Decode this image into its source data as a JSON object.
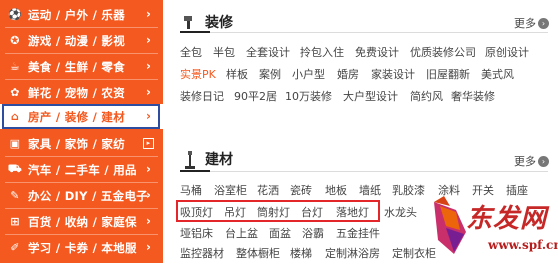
{
  "sidebar": {
    "items": [
      {
        "label": "运动 / 户外 / 乐器",
        "icon": "sports-icon"
      },
      {
        "label": "游戏 / 动漫 / 影视",
        "icon": "game-icon"
      },
      {
        "label": "美食 / 生鲜 / 零食",
        "icon": "food-icon"
      },
      {
        "label": "鲜花 / 宠物 / 农资",
        "icon": "flower-icon"
      },
      {
        "label": "房产 / 装修 / 建材",
        "icon": "house-icon",
        "active": true
      },
      {
        "label": "家具 / 家饰 / 家纺",
        "icon": "furniture-icon"
      },
      {
        "label": "汽车 / 二手车 / 用品",
        "icon": "car-icon"
      },
      {
        "label": "办公 / DIY / 五金电子",
        "icon": "office-icon"
      },
      {
        "label": "百货 / 收纳 / 家庭保",
        "icon": "store-icon"
      },
      {
        "label": "学习 / 卡券 / 本地服",
        "icon": "study-icon"
      }
    ]
  },
  "decoration": {
    "title": "装修",
    "more": "更多",
    "tags_row1": [
      "全包",
      "半包",
      "全套设计",
      "拎包入住",
      "免费设计",
      "优质装修公司",
      "原创设计"
    ],
    "tags_row2": [
      "实景PK",
      "样板",
      "案例",
      "小户型",
      "婚房",
      "家装设计",
      "旧屋翻新",
      "美式风"
    ],
    "tags_row3": [
      "装修日记",
      "90平2居",
      "10万装修",
      "大户型设计",
      "简约风",
      "奢华装修"
    ]
  },
  "materials": {
    "title": "建材",
    "more": "更多",
    "tags_row1": [
      "马桶",
      "浴室柜",
      "花洒",
      "瓷砖",
      "地板",
      "墙纸",
      "乳胶漆",
      "涂料",
      "开关",
      "插座"
    ],
    "tags_row2": [
      "吸顶灯",
      "吊灯",
      "筒射灯",
      "台灯",
      "落地灯",
      "水龙头"
    ],
    "tags_row3": [
      "垭铝床",
      "台上盆",
      "面盆",
      "浴霸",
      "五金挂件"
    ],
    "tags_row4": [
      "监控器材",
      "整体橱柜",
      "楼梯",
      "定制淋浴房",
      "定制衣柜"
    ]
  },
  "watermark": {
    "brand": "东发网",
    "url": "www.spf.cn"
  },
  "colors": {
    "accent": "#f4591f",
    "active_frame": "#2e4d9e",
    "highlight_frame": "#e3262a"
  }
}
